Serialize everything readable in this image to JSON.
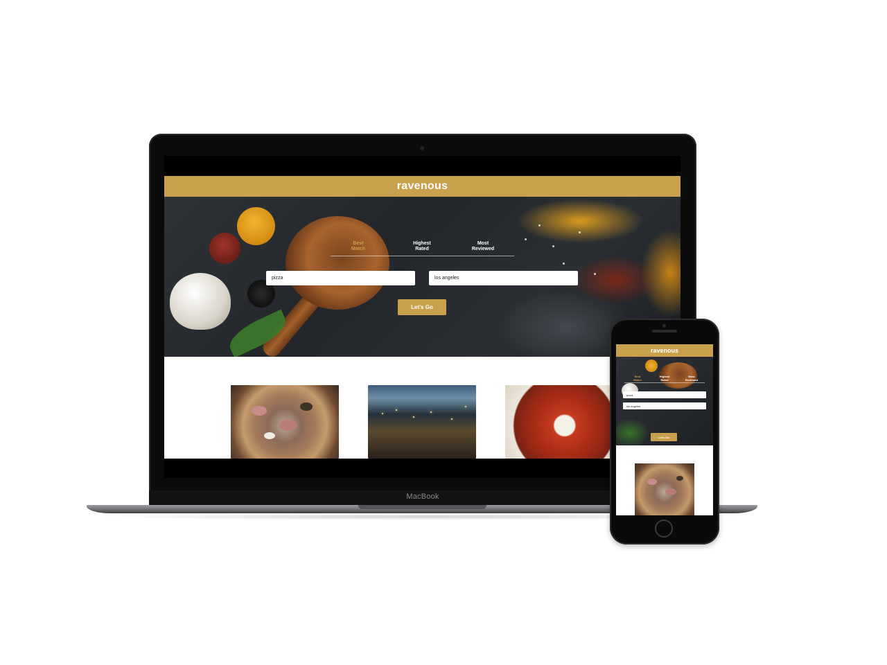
{
  "laptop": {
    "label": "MacBook"
  },
  "site": {
    "brand": "ravenous",
    "tabs": [
      {
        "line1": "Best",
        "line2": "Match",
        "active": true
      },
      {
        "line1": "Highest",
        "line2": "Rated",
        "active": false
      },
      {
        "line1": "Most",
        "line2": "Reviewed",
        "active": false
      }
    ],
    "search": {
      "term_value": "pizza",
      "location_value": "los angeles"
    },
    "submit_label": "Let's Go",
    "results_images": [
      "pizza-photo",
      "restaurant-interior-photo",
      "lasagna-photo"
    ]
  },
  "phone": {
    "brand": "ravenous",
    "tabs": [
      {
        "line1": "Best",
        "line2": "Match",
        "active": true
      },
      {
        "line1": "Highest",
        "line2": "Rated",
        "active": false
      },
      {
        "line1": "Most",
        "line2": "Reviewed",
        "active": false
      }
    ],
    "search": {
      "term_value": "pizza",
      "location_value": "los angeles"
    },
    "submit_label": "Let's Go"
  },
  "colors": {
    "accent": "#c9a04b",
    "device": "#0b0b0c",
    "page": "#ffffff"
  }
}
